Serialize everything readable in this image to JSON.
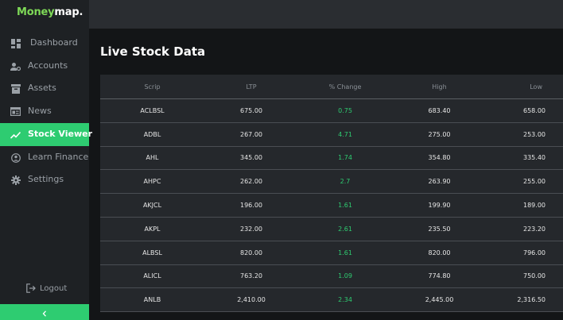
{
  "logo": {
    "part1": "Money",
    "part2": "map",
    "dot": "."
  },
  "nav": [
    {
      "label": "Dashboard",
      "icon": "dashboard-icon"
    },
    {
      "label": "Accounts",
      "icon": "accounts-icon"
    },
    {
      "label": "Assets",
      "icon": "assets-icon"
    },
    {
      "label": "News",
      "icon": "news-icon"
    },
    {
      "label": "Stock Viewer",
      "icon": "trending-up-icon",
      "active": true
    },
    {
      "label": "Learn Finance",
      "icon": "learn-icon"
    },
    {
      "label": "Settings",
      "icon": "gear-icon"
    }
  ],
  "logout_label": "Logout",
  "page_title": "Live Stock Data",
  "table": {
    "headers": [
      "Scrip",
      "LTP",
      "% Change",
      "High",
      "Low"
    ],
    "rows": [
      [
        "ACLBSL",
        "675.00",
        "0.75",
        "683.40",
        "658.00"
      ],
      [
        "ADBL",
        "267.00",
        "4.71",
        "275.00",
        "253.00"
      ],
      [
        "AHL",
        "345.00",
        "1.74",
        "354.80",
        "335.40"
      ],
      [
        "AHPC",
        "262.00",
        "2.7",
        "263.90",
        "255.00"
      ],
      [
        "AKJCL",
        "196.00",
        "1.61",
        "199.90",
        "189.00"
      ],
      [
        "AKPL",
        "232.00",
        "2.61",
        "235.50",
        "223.20"
      ],
      [
        "ALBSL",
        "820.00",
        "1.61",
        "820.00",
        "796.00"
      ],
      [
        "ALICL",
        "763.20",
        "1.09",
        "774.80",
        "750.00"
      ],
      [
        "ANLB",
        "2,410.00",
        "2.34",
        "2,445.00",
        "2,316.50"
      ]
    ]
  },
  "colors": {
    "accent": "#2ecc71",
    "logo_green": "#7ed957",
    "sidebar": "#1e2124",
    "background": "#131517"
  }
}
